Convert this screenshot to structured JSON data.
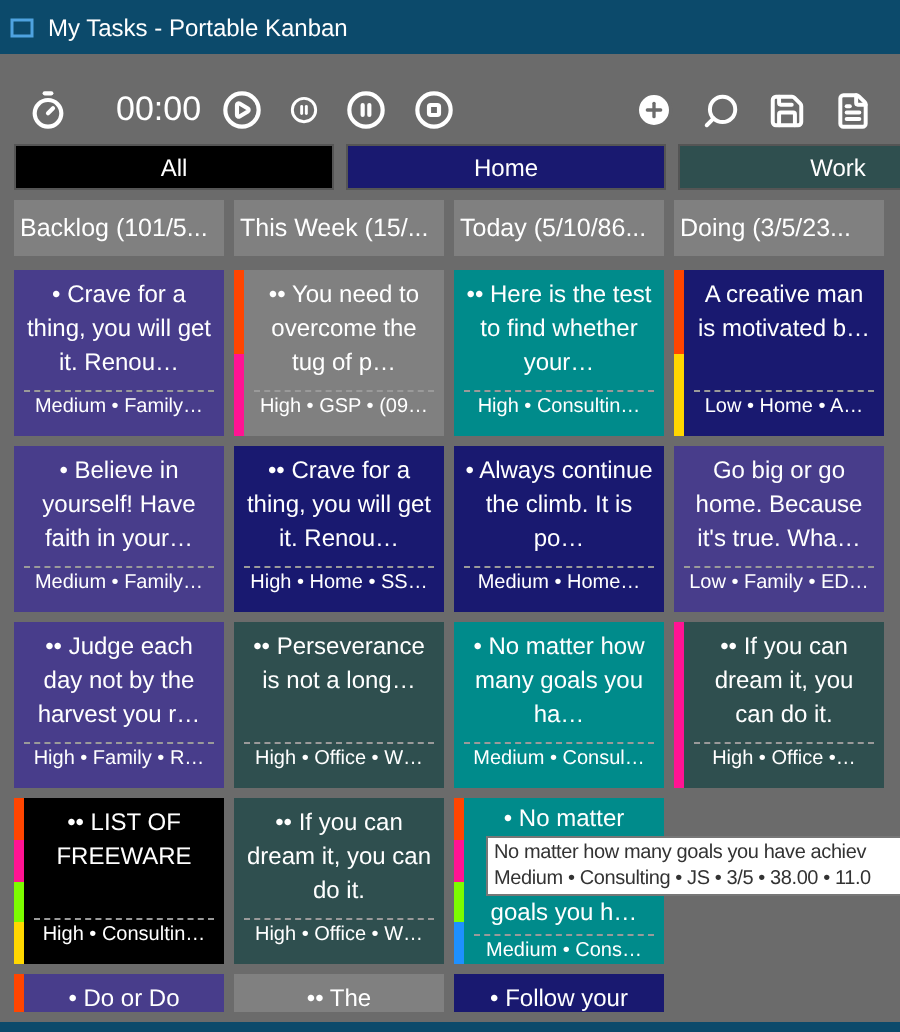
{
  "window": {
    "title": "My Tasks - Portable Kanban"
  },
  "toolbar": {
    "timer": "00:00"
  },
  "tabs": [
    {
      "label": "All",
      "color": "#000000"
    },
    {
      "label": "Home",
      "color": "#191970"
    },
    {
      "label": "Work",
      "color": "#2f4f4f"
    }
  ],
  "columns": [
    {
      "title": "Backlog (101/5...",
      "cards": [
        {
          "text": "• Crave for a thing, you will get it. Renou…",
          "meta": "Medium • Family…",
          "color": "#483d8b"
        },
        {
          "text": "• Believe in yourself! Have faith in your…",
          "meta": "Medium • Family…",
          "color": "#483d8b"
        },
        {
          "text": "•• Judge each day not by the harvest you r…",
          "meta": "High • Family • R…",
          "color": "#483d8b"
        },
        {
          "text": "•• LIST OF FREEWARE",
          "meta": "High • Consultin…",
          "color": "#000000",
          "flags": [
            {
              "color": "#ff4500"
            },
            {
              "color": "#ff1493"
            },
            {
              "color": "#7cfc00"
            },
            {
              "color": "#ffd700"
            }
          ]
        },
        {
          "text": "• Do or Do",
          "color": "#483d8b",
          "flags": [
            {
              "color": "#ff4500"
            }
          ]
        }
      ]
    },
    {
      "title": "This Week (15/...",
      "cards": [
        {
          "text": "•• You need to overcome the tug of p…",
          "meta": "High • GSP • (09…",
          "color": "#808080",
          "flags": [
            {
              "color": "#ff4500"
            },
            {
              "color": "#ff1493"
            }
          ]
        },
        {
          "text": "•• Crave for a thing, you will get it. Renou…",
          "meta": "High • Home • SS…",
          "color": "#191970"
        },
        {
          "text": "•• Perseverance is not a long…",
          "meta": "High • Office • W…",
          "color": "#2f4f4f"
        },
        {
          "text": "•• If you can dream it, you can do it.",
          "meta": "High • Office • W…",
          "color": "#2f4f4f"
        },
        {
          "text": "•• The",
          "color": "#808080"
        }
      ]
    },
    {
      "title": "Today (5/10/86...",
      "cards": [
        {
          "text": "•• Here is the test to find whether your…",
          "meta": "High • Consultin…",
          "color": "#008b8b"
        },
        {
          "text": "• Always continue the climb. It is po…",
          "meta": "Medium • Home…",
          "color": "#191970"
        },
        {
          "text": "• No matter how many goals you ha…",
          "meta": "Medium • Consul…",
          "color": "#008b8b"
        },
        {
          "text": "• No matter",
          "text_below": "goals you h…",
          "meta": "Medium • Cons…",
          "color": "#008b8b",
          "flags": [
            {
              "color": "#ff4500"
            },
            {
              "color": "#ff1493"
            },
            {
              "color": "#7cfc00"
            },
            {
              "color": "#1e90ff"
            }
          ]
        },
        {
          "text": "• Follow your",
          "color": "#191970"
        }
      ]
    },
    {
      "title": "Doing (3/5/23...",
      "cards": [
        {
          "text": "A creative man is motivated b…",
          "meta": "Low • Home • A…",
          "color": "#191970",
          "flags": [
            {
              "color": "#ff4500"
            },
            {
              "color": "#ffd700"
            }
          ]
        },
        {
          "text": "Go big or go home. Because it's true. Wha…",
          "meta": "Low • Family • ED…",
          "color": "#483d8b"
        },
        {
          "text": "•• If you can dream it, you can do it.",
          "meta": "High • Office •…",
          "color": "#2f4f4f",
          "flags": [
            {
              "color": "#ff1493"
            }
          ]
        }
      ]
    }
  ],
  "tooltip": {
    "lines": [
      "No matter how many goals you have achiev",
      "Medium • Consulting • JS • 3/5 • 38.00 • 11.0"
    ]
  }
}
